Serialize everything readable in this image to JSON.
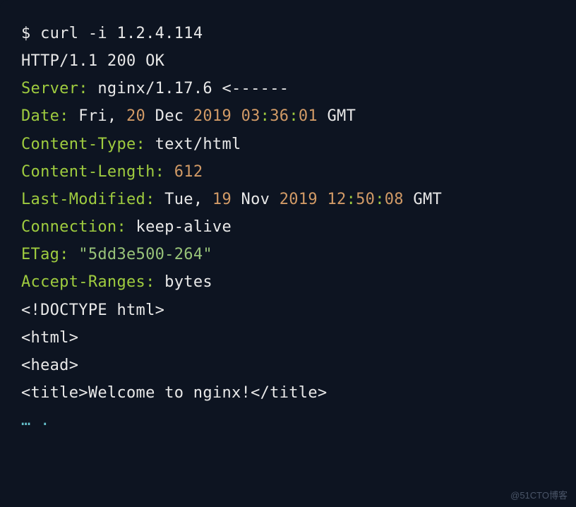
{
  "terminal": {
    "prompt": "$ ",
    "command": "curl -i 1.2.4.114",
    "statusLine": "HTTP/1.1 200 OK",
    "headers": {
      "server": {
        "key": "Server:",
        "value": " nginx/1.17.6 ",
        "annotation": "<------"
      },
      "date": {
        "key": "Date:",
        "day": " Fri, ",
        "dayNum": "20",
        "month": " Dec ",
        "year": "2019",
        "space": " ",
        "hour": "03",
        "colon1": ":",
        "min": "36",
        "colon2": ":",
        "sec": "01",
        "tz": " GMT"
      },
      "contentType": {
        "key": "Content-Type:",
        "value": " text/html"
      },
      "contentLength": {
        "key": "Content-Length:",
        "space": " ",
        "value": "612"
      },
      "lastModified": {
        "key": "Last-Modified:",
        "day": " Tue, ",
        "dayNum": "19",
        "month": " Nov ",
        "year": "2019",
        "space": " ",
        "hour": "12",
        "colon1": ":",
        "min": "50",
        "colon2": ":",
        "sec": "08",
        "tz": " GMT"
      },
      "connection": {
        "key": "Connection:",
        "value": " keep-alive"
      },
      "etag": {
        "key": "ETag:",
        "space": " ",
        "value": "\"5dd3e500-264\""
      },
      "acceptRanges": {
        "key": "Accept-Ranges:",
        "value": " bytes"
      }
    },
    "body": {
      "doctype": "<!DOCTYPE html>",
      "htmlOpen": "<html>",
      "headOpen": "<head>",
      "titleLine": "<title>Welcome to nginx!</title>",
      "ellipsis": "… .",
      "ellipsisSpace": " "
    }
  },
  "watermark": "@51CTO博客"
}
